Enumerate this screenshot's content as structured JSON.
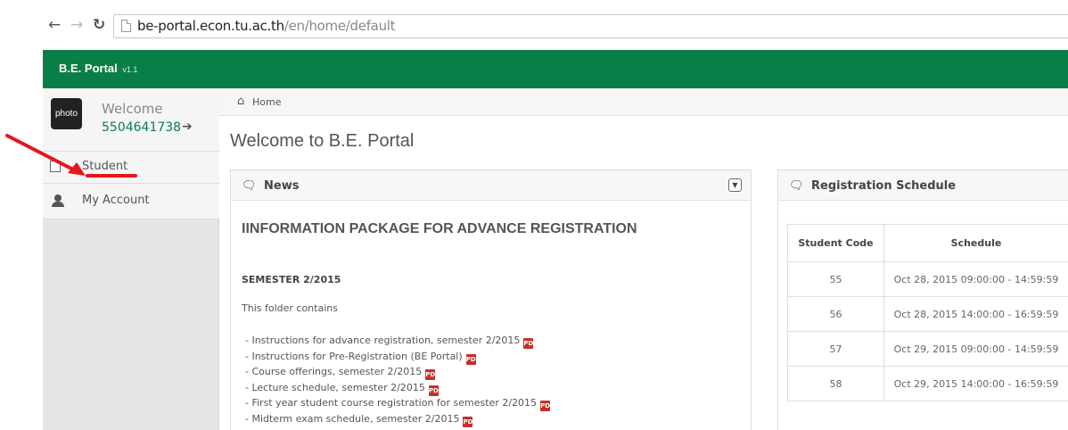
{
  "browser": {
    "url_host": "be-portal.econ.tu.ac.th",
    "url_path": "/en/home/default",
    "icons": {
      "back": "back-arrow-icon",
      "forward": "forward-arrow-icon",
      "reload": "reload-icon",
      "page": "page-icon"
    }
  },
  "header": {
    "brand": "B.E. Portal",
    "version": "v1.1"
  },
  "sidebar": {
    "avatar_text": "photo",
    "welcome": "Welcome",
    "user_id": "5504641738",
    "items": [
      {
        "label": "Student",
        "icon": "document-icon"
      },
      {
        "label": "My Account",
        "icon": "user-icon"
      }
    ]
  },
  "breadcrumb": {
    "home": "Home"
  },
  "main": {
    "page_title": "Welcome to B.E. Portal",
    "news": {
      "title": "News",
      "headline": "IINFORMATION PACKAGE FOR ADVANCE REGISTRATION",
      "semester": "SEMESTER 2/2015",
      "intro": "This folder contains",
      "pdf_label": "PDF",
      "items": [
        "- Instructions for advance registration, semester 2/2015",
        "- Instructions for Pre-Registration (BE Portal)",
        "- Course offerings, semester 2/2015",
        "- Lecture schedule, semester 2/2015",
        "- First year student course registration for semester 2/2015",
        "- Midterm exam schedule, semester 2/2015"
      ]
    },
    "registration": {
      "title": "Registration Schedule",
      "columns": [
        "Student Code",
        "Schedule"
      ],
      "rows": [
        [
          "55",
          "Oct 28, 2015 09:00:00 - 14:59:59"
        ],
        [
          "56",
          "Oct 28, 2015 14:00:00 - 16:59:59"
        ],
        [
          "57",
          "Oct 29, 2015 09:00:00 - 14:59:59"
        ],
        [
          "58",
          "Oct 29, 2015 14:00:00 - 16:59:59"
        ]
      ]
    }
  },
  "colors": {
    "brand_green": "#0a7e47",
    "annotation_red": "#e8141c",
    "pdf_red": "#c4302b"
  }
}
